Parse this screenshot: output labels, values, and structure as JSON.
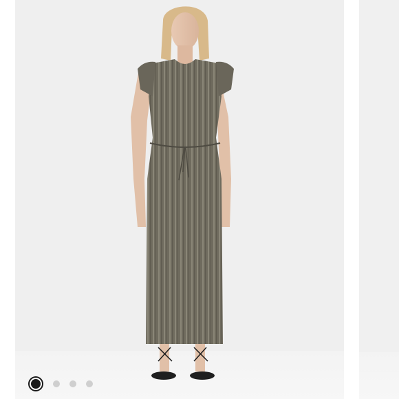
{
  "carousel": {
    "slides": [
      {
        "image": "model-wearing-striped-midi-dress"
      },
      {
        "image": "next-product-photo"
      }
    ],
    "current_index": 1,
    "total_slides": 4,
    "indicator_icons": [
      "radio-selected-icon",
      "dot-icon",
      "dot-icon",
      "dot-icon"
    ]
  },
  "colors": {
    "backdrop": "#efefef",
    "dress": "#6e6a5d",
    "active_dot": "#1a1a1a",
    "inactive_dot": "#cfcfcf"
  }
}
